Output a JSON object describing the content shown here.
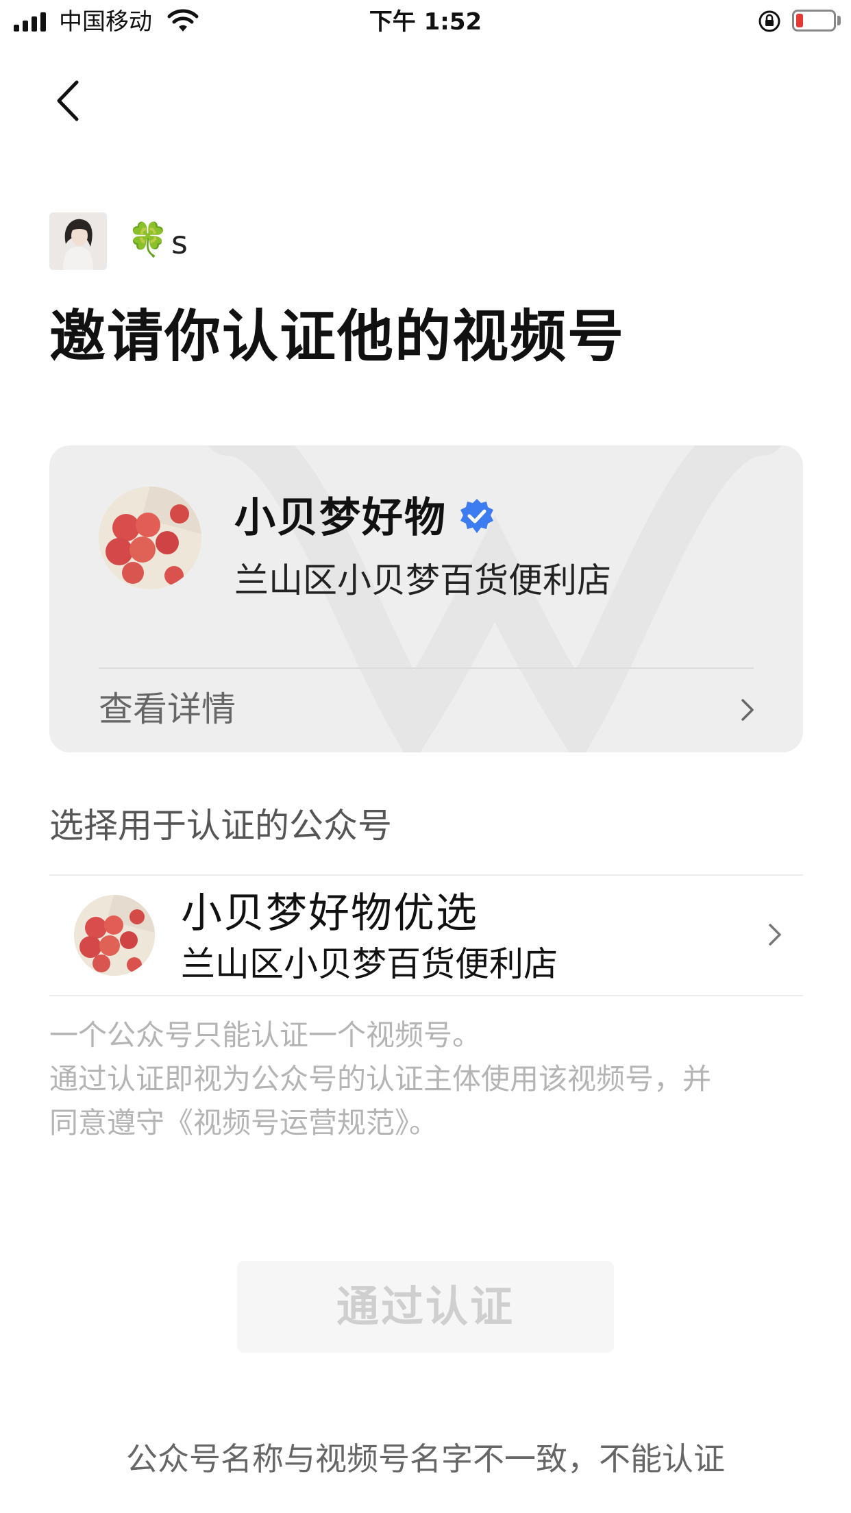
{
  "status_bar": {
    "carrier": "中国移动",
    "time": "下午 1:52",
    "icons": [
      "signal-icon",
      "wifi-icon",
      "rotation-lock-icon",
      "battery-icon"
    ],
    "battery_color": "#e53935"
  },
  "inviter": {
    "emoji": "🍀",
    "name": "s"
  },
  "title": "邀请你认证他的视频号",
  "channel_card": {
    "name": "小贝梦好物",
    "subtitle": "兰山区小贝梦百货便利店",
    "detail_label": "查看详情",
    "verify_color": "#3d7bf0"
  },
  "section": {
    "title": "选择用于认证的公众号"
  },
  "official_account": {
    "name": "小贝梦好物优选",
    "subtitle": "兰山区小贝梦百货便利店"
  },
  "notes": [
    "一个公众号只能认证一个视频号。",
    "通过认证即视为公众号的认证主体使用该视频号，并",
    "同意遵守《视频号运营规范》。"
  ],
  "button": {
    "label": "通过认证"
  },
  "warning": "公众号名称与视频号名字不一致，不能认证"
}
